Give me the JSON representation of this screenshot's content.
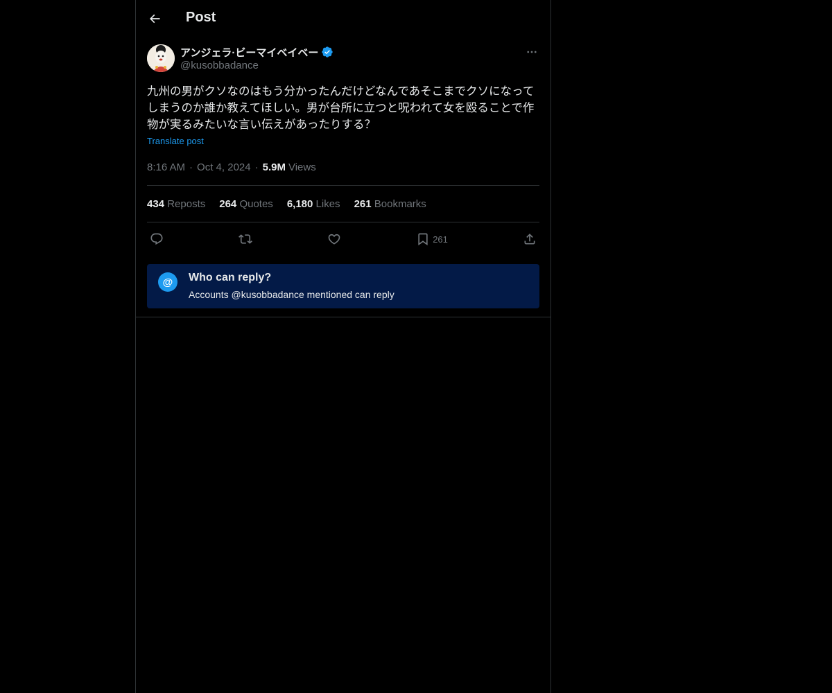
{
  "header": {
    "title": "Post"
  },
  "author": {
    "display_name": "アンジェラ·ビーマイベイベー",
    "handle": "@kusobbadance",
    "verified_color": "#1d9bf0"
  },
  "post": {
    "text": "九州の男がクソなのはもう分かったんだけどなんであそこまでクソになってしまうのか誰か教えてほしい。男が台所に立つと呪われて女を殴ることで作物が実るみたいな言い伝えがあったりする？",
    "translate_label": "Translate post",
    "time": "8:16 AM",
    "date": "Oct 4, 2024",
    "views_count": "5.9M",
    "views_label": "Views"
  },
  "stats": {
    "reposts_count": "434",
    "reposts_label": "Reposts",
    "quotes_count": "264",
    "quotes_label": "Quotes",
    "likes_count": "6,180",
    "likes_label": "Likes",
    "bookmarks_count": "261",
    "bookmarks_label": "Bookmarks"
  },
  "actions": {
    "icons": [
      "reply-icon",
      "repost-icon",
      "like-icon",
      "bookmark-icon",
      "share-icon"
    ],
    "bookmark_count": "261"
  },
  "reply_restriction": {
    "title": "Who can reply?",
    "subtitle": "Accounts @kusobbadance mentioned can reply",
    "icon_glyph": "@",
    "bg_color": "#031a47",
    "accent_color": "#1d9bf0"
  },
  "colors": {
    "background": "#000000",
    "text": "#e7e9ea",
    "muted": "#71767b",
    "border": "#2f3336",
    "link": "#1d9bf0"
  }
}
